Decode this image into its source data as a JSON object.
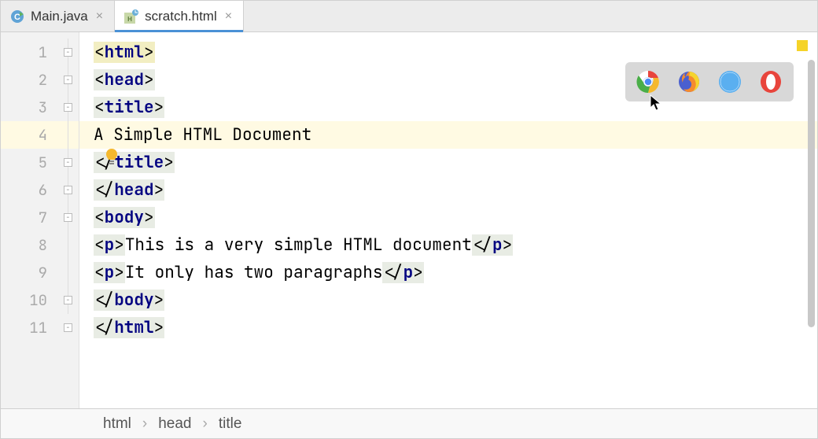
{
  "tabs": [
    {
      "label": "Main.java",
      "active": false,
      "icon": "java-class"
    },
    {
      "label": "scratch.html",
      "active": true,
      "icon": "html-scratch"
    }
  ],
  "gutter": {
    "lines": [
      1,
      2,
      3,
      4,
      5,
      6,
      7,
      8,
      9,
      10,
      11
    ]
  },
  "code": {
    "l1_tag": "html",
    "l2_tag": "head",
    "l3_tag": "title",
    "l4_text": "A Simple HTML Document",
    "l5_tag": "title",
    "l6_tag": "head",
    "l7_tag": "body",
    "l8_tag": "p",
    "l8_text": "This is a very simple HTML document",
    "l9_tag": "p",
    "l9_text": "It only has two paragraphs",
    "l10_tag": "body",
    "l11_tag": "html"
  },
  "browsers": [
    "chrome",
    "firefox",
    "safari",
    "opera"
  ],
  "breadcrumb": {
    "items": [
      "html",
      "head",
      "title"
    ],
    "sep": "›"
  },
  "icons": {
    "intention_bulb": "bulb"
  }
}
